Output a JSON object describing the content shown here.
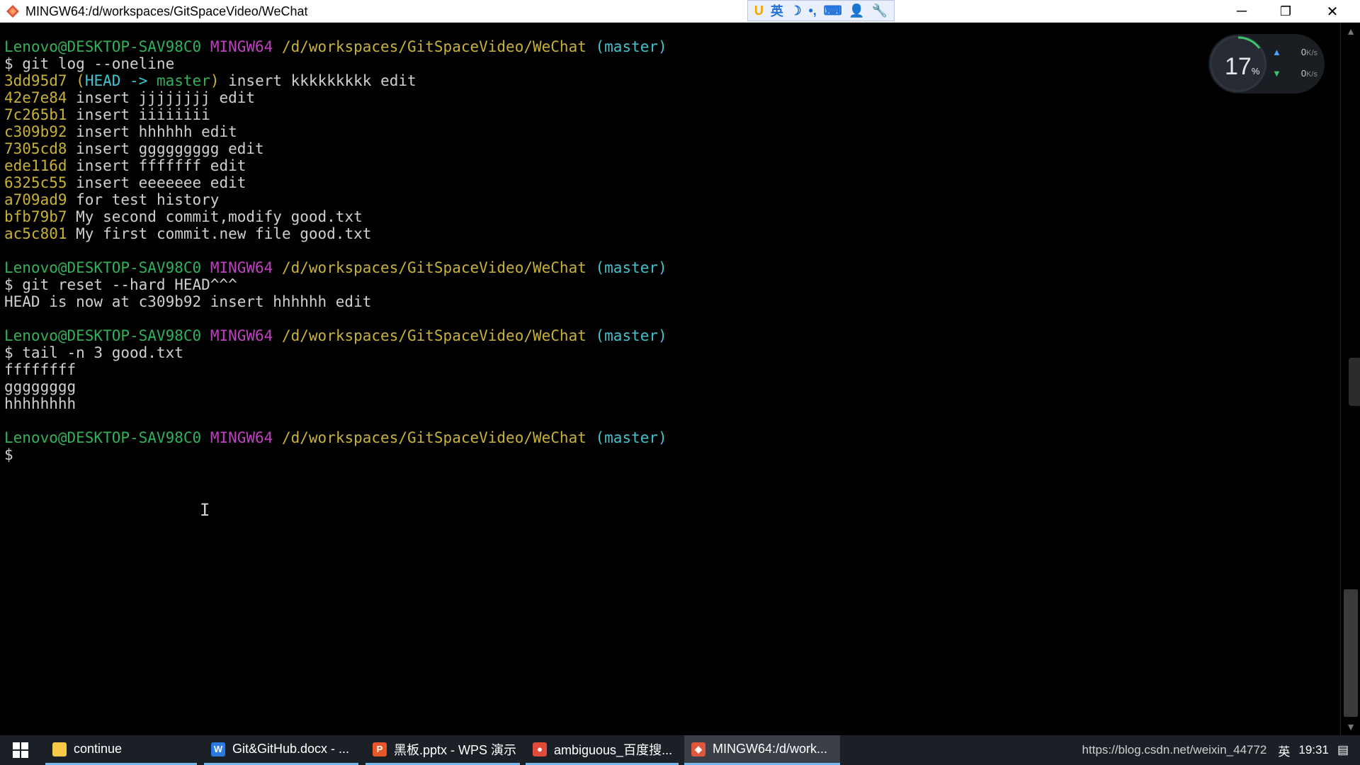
{
  "window": {
    "title": "MINGW64:/d/workspaces/GitSpaceVideo/WeChat",
    "minimize": "─",
    "restore": "❐",
    "close": "✕"
  },
  "ime_bar": {
    "items": [
      "U",
      "英",
      "☽",
      "•,",
      "⌨",
      "👤",
      "🔧"
    ]
  },
  "terminal": {
    "lines": [
      {
        "type": "prompt",
        "user": "Lenovo@DESKTOP-SAV98C0",
        "shell": "MINGW64",
        "path": "/d/workspaces/GitSpaceVideo/WeChat",
        "branch": "(master)"
      },
      {
        "type": "text",
        "text": "$ git log --oneline"
      },
      {
        "type": "commit_head",
        "hash": "3dd95d7",
        "ref_open": "(",
        "ref_head": "HEAD -> ",
        "ref_branch": "master",
        "ref_close": ")",
        "message": " insert kkkkkkkkk edit"
      },
      {
        "type": "commit",
        "hash": "42e7e84",
        "message": " insert jjjjjjjj edit"
      },
      {
        "type": "commit",
        "hash": "7c265b1",
        "message": " insert iiiiiiii"
      },
      {
        "type": "commit",
        "hash": "c309b92",
        "message": " insert hhhhhh edit"
      },
      {
        "type": "commit",
        "hash": "7305cd8",
        "message": " insert ggggggggg edit"
      },
      {
        "type": "commit",
        "hash": "ede116d",
        "message": " insert fffffff edit"
      },
      {
        "type": "commit",
        "hash": "6325c55",
        "message": " insert eeeeeee edit"
      },
      {
        "type": "commit",
        "hash": "a709ad9",
        "message": " for test history"
      },
      {
        "type": "commit",
        "hash": "bfb79b7",
        "message": " My second commit,modify good.txt"
      },
      {
        "type": "commit",
        "hash": "ac5c801",
        "message": " My first commit.new file good.txt"
      },
      {
        "type": "blank"
      },
      {
        "type": "prompt",
        "user": "Lenovo@DESKTOP-SAV98C0",
        "shell": "MINGW64",
        "path": "/d/workspaces/GitSpaceVideo/WeChat",
        "branch": "(master)"
      },
      {
        "type": "text",
        "text": "$ git reset --hard HEAD^^^"
      },
      {
        "type": "text",
        "text": "HEAD is now at c309b92 insert hhhhhh edit"
      },
      {
        "type": "blank"
      },
      {
        "type": "prompt",
        "user": "Lenovo@DESKTOP-SAV98C0",
        "shell": "MINGW64",
        "path": "/d/workspaces/GitSpaceVideo/WeChat",
        "branch": "(master)"
      },
      {
        "type": "text",
        "text": "$ tail -n 3 good.txt"
      },
      {
        "type": "text",
        "text": "ffffffff"
      },
      {
        "type": "text",
        "text": "gggggggg"
      },
      {
        "type": "text",
        "text": "hhhhhhhh"
      },
      {
        "type": "blank"
      },
      {
        "type": "prompt",
        "user": "Lenovo@DESKTOP-SAV98C0",
        "shell": "MINGW64",
        "path": "/d/workspaces/GitSpaceVideo/WeChat",
        "branch": "(master)"
      },
      {
        "type": "text",
        "text": "$"
      }
    ]
  },
  "net_widget": {
    "percent": "17",
    "percent_unit": "%",
    "upload": "0",
    "download": "0",
    "rate_unit": "K/s"
  },
  "taskbar": {
    "items": [
      {
        "label": "continue",
        "icon": "folder-icon",
        "color": "#f7c948",
        "glyph": ""
      },
      {
        "label": "Git&GitHub.docx - ...",
        "icon": "wps-writer-icon",
        "color": "#2a7ae2",
        "glyph": "W"
      },
      {
        "label": "黑板.pptx - WPS 演示",
        "icon": "wps-presentation-icon",
        "color": "#e8572a",
        "glyph": "P"
      },
      {
        "label": "ambiguous_百度搜...",
        "icon": "chrome-icon",
        "color": "#e04b3a",
        "glyph": "●"
      },
      {
        "label": "MINGW64:/d/work...",
        "icon": "git-bash-icon",
        "color": "#e0563c",
        "glyph": "◆"
      }
    ],
    "tray_url": "https://blog.csdn.net/weixin_44772",
    "tray_lang": "英",
    "tray_time": "19:31"
  },
  "colors": {
    "user": "#2fb25a",
    "shell": "#c040c0",
    "path": "#c9b236",
    "branch": "#3fc4d0",
    "text": "#c0c0c0"
  }
}
